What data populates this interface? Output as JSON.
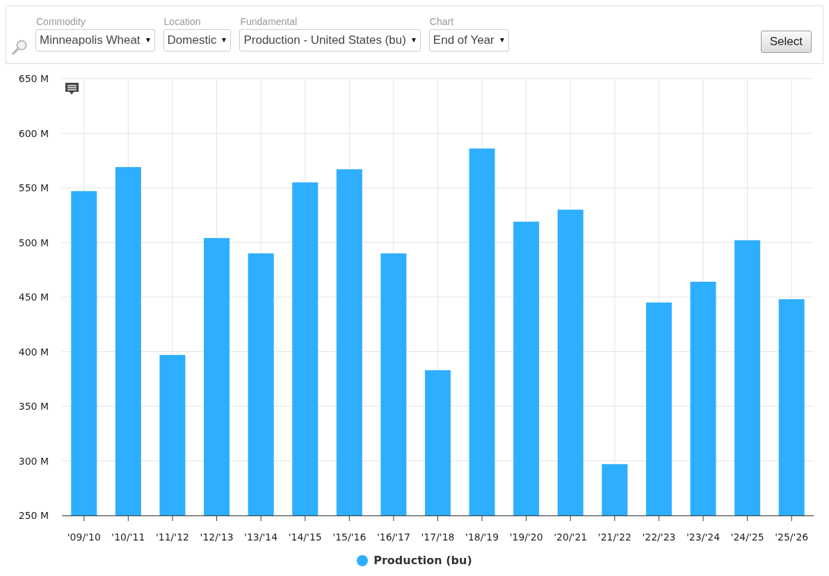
{
  "filters": [
    {
      "label": "Commodity",
      "value": "Minneapolis Wheat"
    },
    {
      "label": "Location",
      "value": "Domestic"
    },
    {
      "label": "Fundamental",
      "value": "Production - United States (bu)"
    },
    {
      "label": "Chart",
      "value": "End of Year"
    }
  ],
  "select_button": "Select",
  "chart": {
    "chart_data": {
      "type": "bar",
      "categories": [
        "'09/'10",
        "'10/'11",
        "'11/'12",
        "'12/'13",
        "'13/'14",
        "'14/'15",
        "'15/'16",
        "'16/'17",
        "'17/'18",
        "'18/'19",
        "'19/'20",
        "'20/'21",
        "'21/'22",
        "'22/'23",
        "'23/'24",
        "'24/'25",
        "'25/'26"
      ],
      "series": [
        {
          "name": "Production (bu)",
          "color": "#2eaeff",
          "values": [
            547,
            569,
            397,
            504,
            490,
            555,
            567,
            490,
            383,
            586,
            519,
            530,
            297,
            445,
            464,
            502,
            448
          ]
        }
      ],
      "ylim": [
        250,
        650
      ],
      "grid": true,
      "yticks": [
        {
          "value": 250,
          "label": "250 M"
        },
        {
          "value": 300,
          "label": "300 M"
        },
        {
          "value": 350,
          "label": "350 M"
        },
        {
          "value": 400,
          "label": "400 M"
        },
        {
          "value": 450,
          "label": "450 M"
        },
        {
          "value": 500,
          "label": "500 M"
        },
        {
          "value": 550,
          "label": "550 M"
        },
        {
          "value": 600,
          "label": "600 M"
        },
        {
          "value": 650,
          "label": "650 M"
        }
      ]
    }
  }
}
